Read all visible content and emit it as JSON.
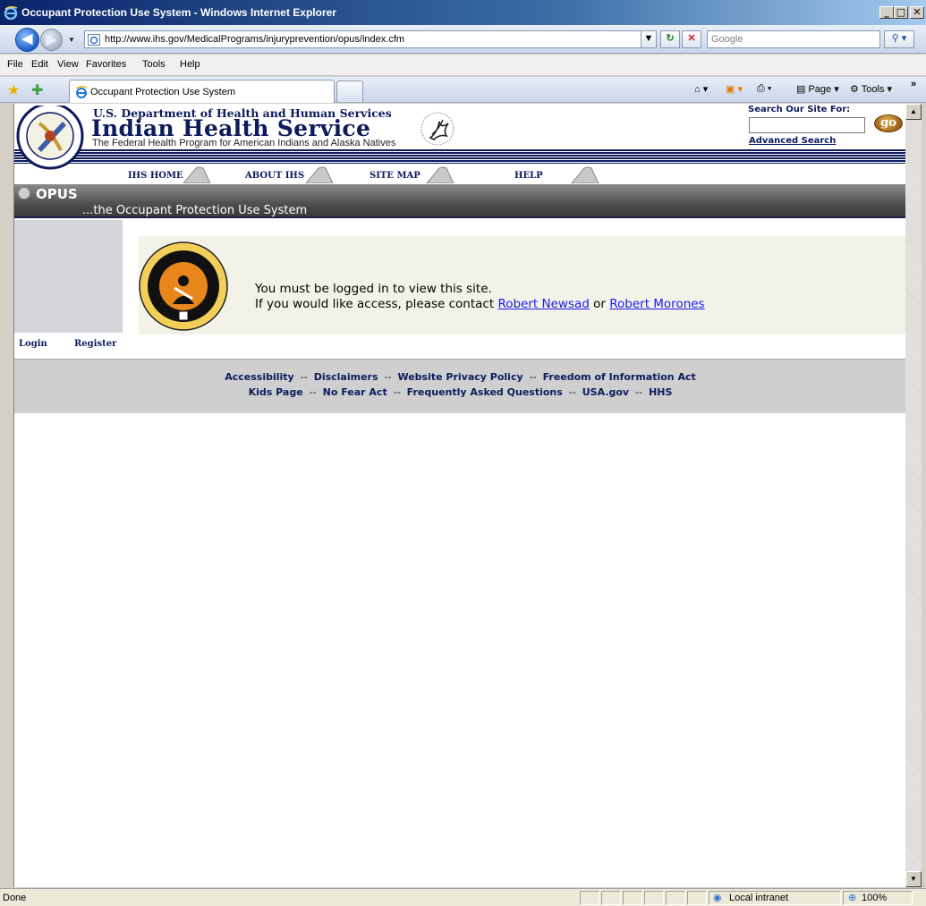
{
  "window": {
    "title": "Occupant Protection Use System - Windows Internet Explorer",
    "minimize": "_",
    "maximize": "□",
    "close": "✕"
  },
  "addressbar": {
    "url": "http://www.ihs.gov/MedicalPrograms/injuryprevention/opus/index.cfm",
    "search_placeholder": "Google"
  },
  "menu": [
    "File",
    "Edit",
    "View",
    "Favorites",
    "Tools",
    "Help"
  ],
  "tab": {
    "label": "Occupant Protection Use System"
  },
  "commandbar": {
    "page": "Page",
    "tools": "Tools"
  },
  "ihs": {
    "department": "U.S. Department of Health and Human Services",
    "agency": "Indian Health Service",
    "tagline": "The Federal Health Program for American Indians and Alaska Natives",
    "search_label": "Search Our Site For:",
    "go": "go",
    "advanced_search": "Advanced Search",
    "nav": [
      "IHS HOME",
      "ABOUT IHS",
      "SITE MAP",
      "HELP"
    ]
  },
  "opus": {
    "title": "OPUS",
    "subtitle": "...the Occupant Protection Use System"
  },
  "sidebar": {
    "login": "Login",
    "register": "Register"
  },
  "notice": {
    "line1": "You must be logged in to view this site.",
    "line2_prefix": "If you would like access, please contact",
    "contact1": "Robert Newsad",
    "or": "or",
    "contact2": "Robert Morones"
  },
  "footer": {
    "row1": [
      "Accessibility",
      "Disclaimers",
      "Website Privacy Policy",
      "Freedom of Information Act"
    ],
    "row2": [
      "Kids Page",
      "No Fear Act",
      "Frequently Asked Questions",
      "USA.gov",
      "HHS"
    ],
    "separator": "--"
  },
  "status": {
    "text": "Done",
    "zone": "Local intranet",
    "zoom": "100%"
  },
  "colors": {
    "navy": "#0d1a5c",
    "link": "#1a1aee"
  }
}
